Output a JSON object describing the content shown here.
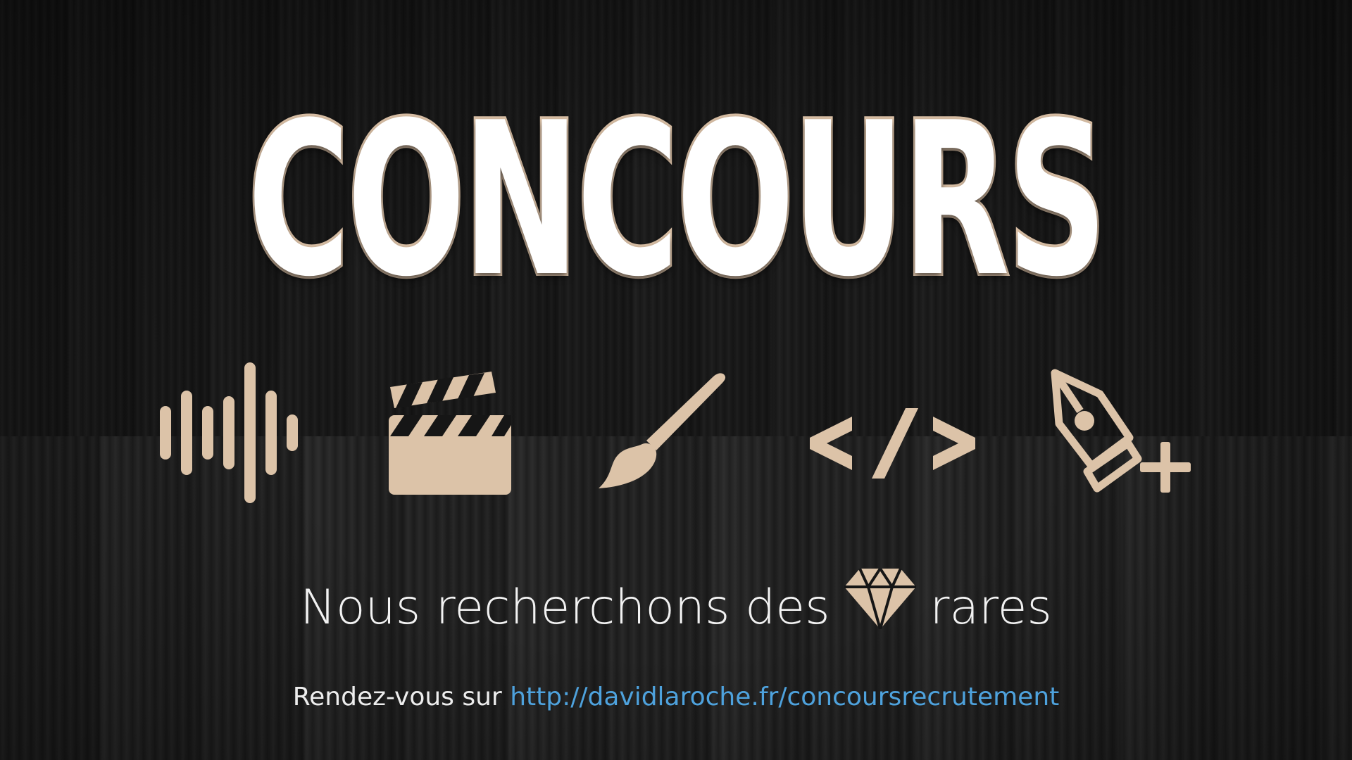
{
  "title": "CONCOURS",
  "icons": [
    "sound-wave-icon",
    "clapperboard-icon",
    "paintbrush-icon",
    "code-icon",
    "pen-tool-add-icon"
  ],
  "tagline": {
    "before": "Nous recherchons des",
    "gem_icon": "diamond-icon",
    "after": "rares"
  },
  "footer": {
    "prefix": "Rendez-vous sur",
    "link": "http://davidlaroche.fr/concoursrecrutement"
  },
  "colors": {
    "accent": "#d9bfa5",
    "link": "#4ea2dd",
    "title_fill": "#ffffff",
    "background": "#161616"
  }
}
